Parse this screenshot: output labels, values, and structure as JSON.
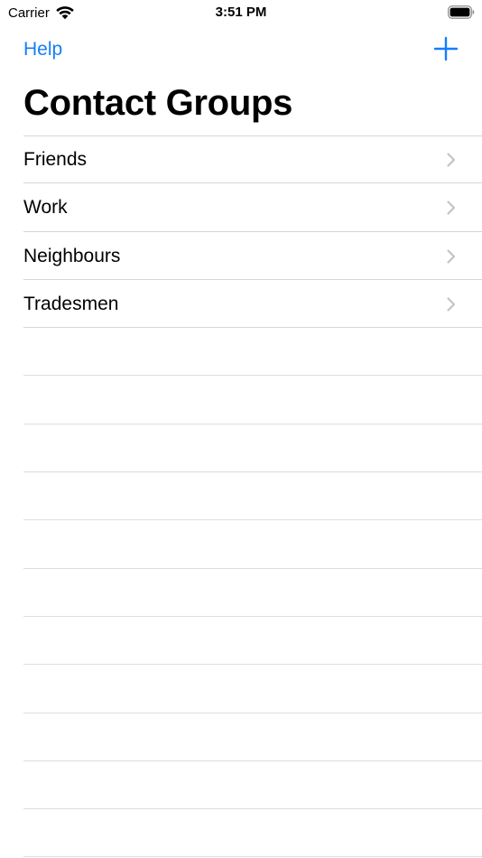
{
  "status_bar": {
    "carrier": "Carrier",
    "time": "3:51 PM",
    "wifi_icon": "wifi-icon",
    "battery_icon": "battery-icon"
  },
  "nav": {
    "help_label": "Help",
    "add_icon": "plus-icon",
    "title": "Contact Groups"
  },
  "groups": [
    {
      "label": "Friends"
    },
    {
      "label": "Work"
    },
    {
      "label": "Neighbours"
    },
    {
      "label": "Tradesmen"
    }
  ],
  "colors": {
    "tint": "#147efb",
    "separator": "#d6d6d9",
    "chevron": "#c4c4c7"
  }
}
